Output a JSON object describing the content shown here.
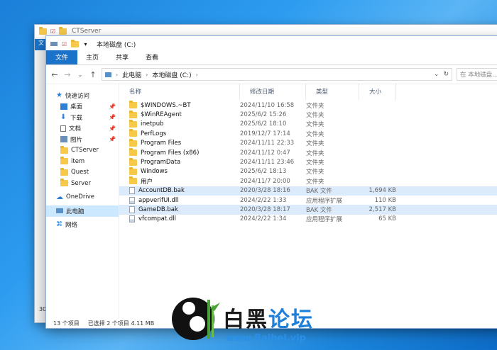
{
  "back_window": {
    "title": "CTServer",
    "ribbon_tab": "文",
    "status_partial": "30"
  },
  "window": {
    "title": "本地磁盘 (C:)"
  },
  "ribbon": {
    "tabs": [
      "文件",
      "主页",
      "共享",
      "查看"
    ]
  },
  "address": {
    "crumbs": [
      "此电脑",
      "本地磁盘 (C:)"
    ],
    "search_placeholder": "在 本地磁盘..."
  },
  "nav": {
    "quick_access": "快速访问",
    "pinned": [
      "桌面",
      "下载",
      "文档",
      "图片"
    ],
    "folders": [
      "CTServer",
      "item",
      "Quest",
      "Server"
    ],
    "onedrive": "OneDrive",
    "this_pc": "此电脑",
    "network": "网络"
  },
  "columns": {
    "name": "名称",
    "date": "修改日期",
    "type": "类型",
    "size": "大小"
  },
  "files": [
    {
      "name": "$WINDOWS.~BT",
      "date": "2024/11/10 16:58",
      "type": "文件夹",
      "size": "",
      "kind": "folder"
    },
    {
      "name": "$WinREAgent",
      "date": "2025/6/2 15:26",
      "type": "文件夹",
      "size": "",
      "kind": "folder"
    },
    {
      "name": "inetpub",
      "date": "2025/6/2 18:10",
      "type": "文件夹",
      "size": "",
      "kind": "folder"
    },
    {
      "name": "PerfLogs",
      "date": "2019/12/7 17:14",
      "type": "文件夹",
      "size": "",
      "kind": "folder"
    },
    {
      "name": "Program Files",
      "date": "2024/11/11 22:33",
      "type": "文件夹",
      "size": "",
      "kind": "folder"
    },
    {
      "name": "Program Files (x86)",
      "date": "2024/11/12 0:47",
      "type": "文件夹",
      "size": "",
      "kind": "folder"
    },
    {
      "name": "ProgramData",
      "date": "2024/11/11 23:46",
      "type": "文件夹",
      "size": "",
      "kind": "folder"
    },
    {
      "name": "Windows",
      "date": "2025/6/2 18:13",
      "type": "文件夹",
      "size": "",
      "kind": "folder"
    },
    {
      "name": "用户",
      "date": "2024/11/7 20:00",
      "type": "文件夹",
      "size": "",
      "kind": "folder"
    },
    {
      "name": "AccountDB.bak",
      "date": "2020/3/28 18:16",
      "type": "BAK 文件",
      "size": "1,694 KB",
      "kind": "file",
      "selected": true
    },
    {
      "name": "appverifUI.dll",
      "date": "2024/2/22 1:33",
      "type": "应用程序扩展",
      "size": "110 KB",
      "kind": "dll"
    },
    {
      "name": "GameDB.bak",
      "date": "2020/3/28 18:17",
      "type": "BAK 文件",
      "size": "2,517 KB",
      "kind": "file",
      "selected": true
    },
    {
      "name": "vfcompat.dll",
      "date": "2024/2/22 1:34",
      "type": "应用程序扩展",
      "size": "65 KB",
      "kind": "dll"
    }
  ],
  "status": {
    "count": "13 个项目",
    "selection": "已选择 2 个项目  4.11 MB"
  },
  "watermark": {
    "cn_black": "白黑",
    "cn_blue": "论坛",
    "url": "www.Baihei.vip"
  },
  "colors": {
    "accent": "#1a73c9",
    "selection": "#dcebfc",
    "folder": "#f6c94a"
  }
}
